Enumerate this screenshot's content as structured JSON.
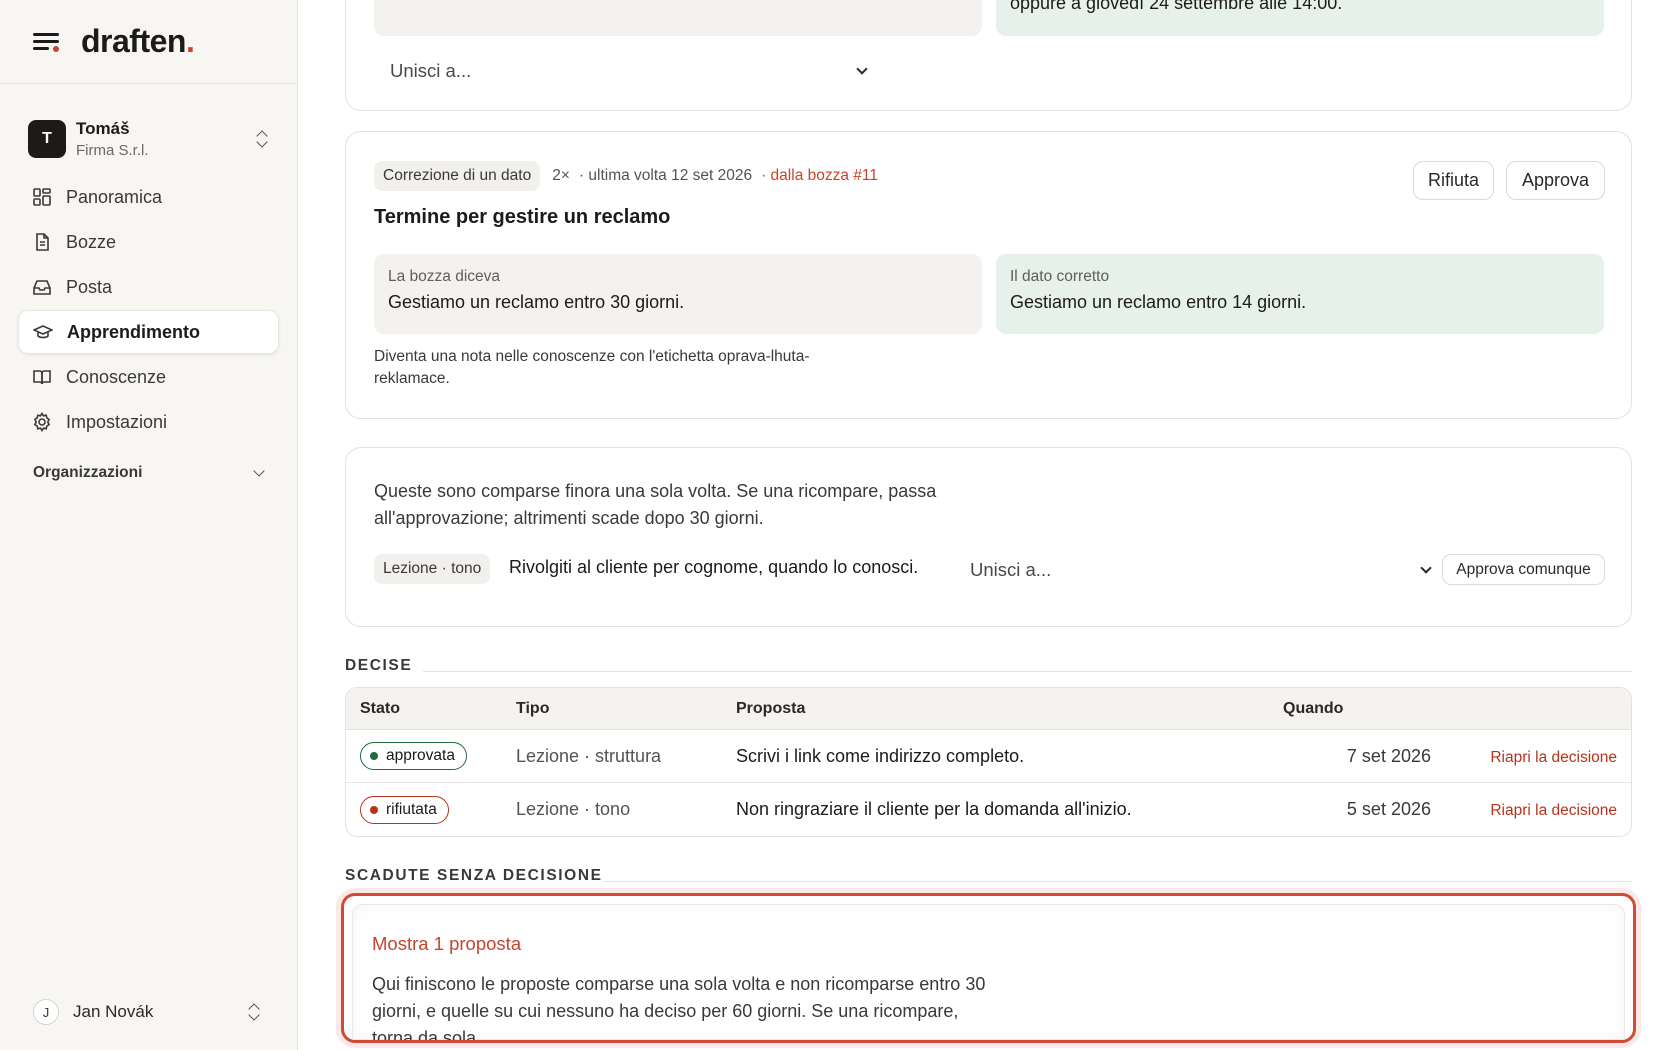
{
  "brand": {
    "name": "draften",
    "period": "."
  },
  "account": {
    "initial": "T",
    "name": "Tomáš",
    "org": "Firma S.r.l."
  },
  "nav": [
    {
      "label": "Panoramica",
      "icon": "grid-icon"
    },
    {
      "label": "Bozze",
      "icon": "document-icon"
    },
    {
      "label": "Posta",
      "icon": "inbox-icon"
    },
    {
      "label": "Apprendimento",
      "icon": "graduation-cap-icon",
      "active": true
    },
    {
      "label": "Conoscenze",
      "icon": "book-icon"
    },
    {
      "label": "Impostazioni",
      "icon": "gear-icon"
    }
  ],
  "organizations_label": "Organizzazioni",
  "user": {
    "initial": "J",
    "name": "Jan Novák"
  },
  "top_card": {
    "green_text": "oppure a giovedì 24 settembre alle 14:00.",
    "merge_placeholder": "Unisci a..."
  },
  "correction_card": {
    "tag": "Correzione di un dato",
    "count": "2×",
    "last_seen": "· ultima volta 12 set 2026",
    "source": "· dalla bozza #11",
    "title": "Termine per gestire un reclamo",
    "old_label": "La bozza diceva",
    "old_text": "Gestiamo un reclamo entro 30 giorni.",
    "new_label": "Il dato corretto",
    "new_text": "Gestiamo un reclamo entro 14 giorni.",
    "note": "Diventa una nota nelle conoscenze con l'etichetta oprava-lhuta-reklamace.",
    "reject_label": "Rifiuta",
    "approve_label": "Approva"
  },
  "single_card": {
    "info": "Queste sono comparse finora una sola volta. Se una ricompare, passa all'approvazione; altrimenti scade dopo 30 giorni.",
    "tag": "Lezione · tono",
    "text": "Rivolgiti al cliente per cognome, quando lo conosci.",
    "merge_placeholder": "Unisci a...",
    "approve_anyway_label": "Approva comunque"
  },
  "decided": {
    "label": "DECISE",
    "headers": {
      "stato": "Stato",
      "tipo": "Tipo",
      "proposta": "Proposta",
      "quando": "Quando"
    },
    "rows": [
      {
        "status": "approvata",
        "type": "Lezione · struttura",
        "proposal": "Scrivi i link come indirizzo completo.",
        "when": "7 set 2026",
        "action": "Riapri la decisione"
      },
      {
        "status": "rifiutata",
        "type": "Lezione · tono",
        "proposal": "Non ringraziare il cliente per la domanda all'inizio.",
        "when": "5 set 2026",
        "action": "Riapri la decisione"
      }
    ]
  },
  "expired": {
    "label": "SCADUTE SENZA DECISIONE",
    "show_label": "Mostra 1 proposta",
    "description": "Qui finiscono le proposte comparse una sola volta e non ricomparse entro 30 giorni, e quelle su cui nessuno ha deciso per 60 giorni. Se una ricompare, torna da sola."
  },
  "colors": {
    "accent": "#c8442c",
    "approved": "#1e6b3d",
    "rejected": "#b8321c",
    "green_box": "#e5f1ea",
    "grey_box": "#f3f2ef"
  }
}
